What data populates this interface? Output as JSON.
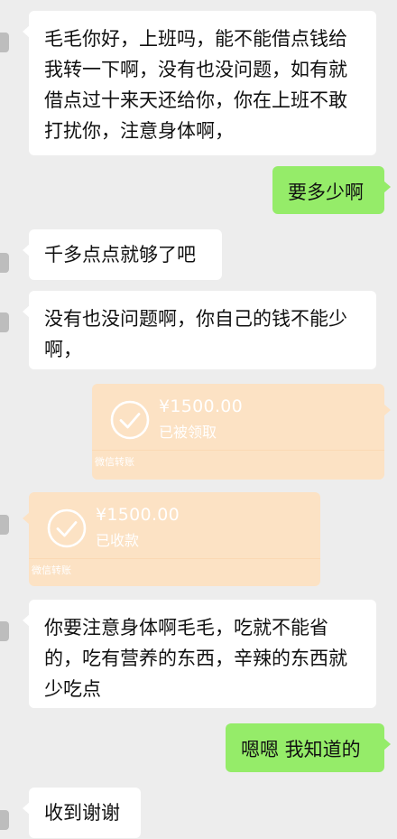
{
  "messages": [
    {
      "side": "left",
      "text": "毛毛你好，上班吗，能不能借点钱给我转一下啊，没有也没问题，如有就借点过十来天还给你，你在上班不敢打扰你，注意身体啊，"
    },
    {
      "side": "right",
      "text": "要多少啊"
    },
    {
      "side": "left",
      "text": "千多点点就够了吧"
    },
    {
      "side": "left",
      "text": "没有也没问题啊，你自己的钱不能少啊，"
    },
    {
      "side": "right",
      "type": "transfer",
      "amount": "¥1500.00",
      "status": "已被领取",
      "footer": "微信转账"
    },
    {
      "side": "left",
      "type": "transfer",
      "amount": "¥1500.00",
      "status": "已收款",
      "footer": "微信转账"
    },
    {
      "side": "left",
      "text": "你要注意身体啊毛毛，吃就不能省的，吃有营养的东西，辛辣的东西就少吃点"
    },
    {
      "side": "right",
      "text": "嗯嗯 我知道的"
    },
    {
      "side": "left",
      "text": "收到谢谢"
    }
  ],
  "colors": {
    "background": "#ededed",
    "incoming_bubble": "#ffffff",
    "outgoing_bubble": "#95ec69",
    "transfer_card": "#fce2c4"
  },
  "icons": {
    "transfer_received": "check-circle-icon"
  }
}
